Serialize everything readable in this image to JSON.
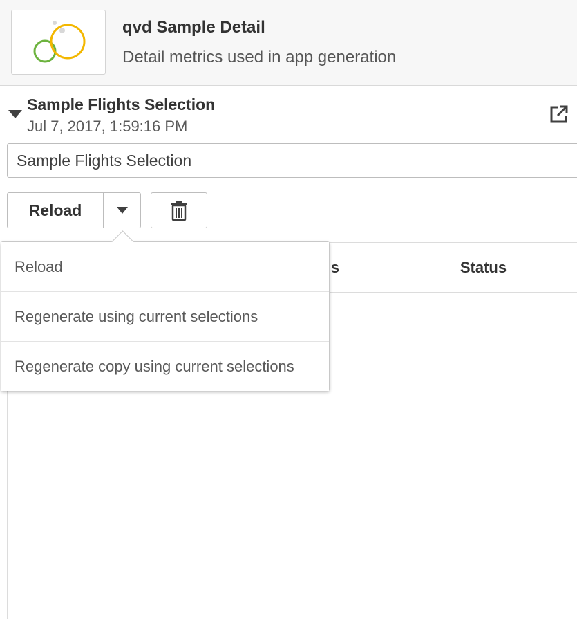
{
  "app": {
    "title": "qvd Sample Detail",
    "subtitle": "Detail metrics used in app generation",
    "thumbnail_icon": "qlik-circles-logo"
  },
  "selection": {
    "title": "Sample Flights Selection",
    "timestamp": "Jul 7, 2017, 1:59:16 PM",
    "name_value": "Sample Flights Selection",
    "collapse_icon": "triangle-down-icon",
    "open_icon": "external-link-icon"
  },
  "toolbar": {
    "reload_label": "Reload",
    "caret_icon": "caret-down-icon",
    "delete_icon": "trash-icon"
  },
  "table": {
    "columns": [
      "s",
      "Status"
    ]
  },
  "menu": {
    "items": [
      "Reload",
      "Regenerate using current selections",
      "Regenerate copy using current selections"
    ]
  },
  "colors": {
    "logo_green": "#6db33f",
    "logo_yellow": "#f3b700",
    "logo_grey": "#d8d8d8"
  }
}
